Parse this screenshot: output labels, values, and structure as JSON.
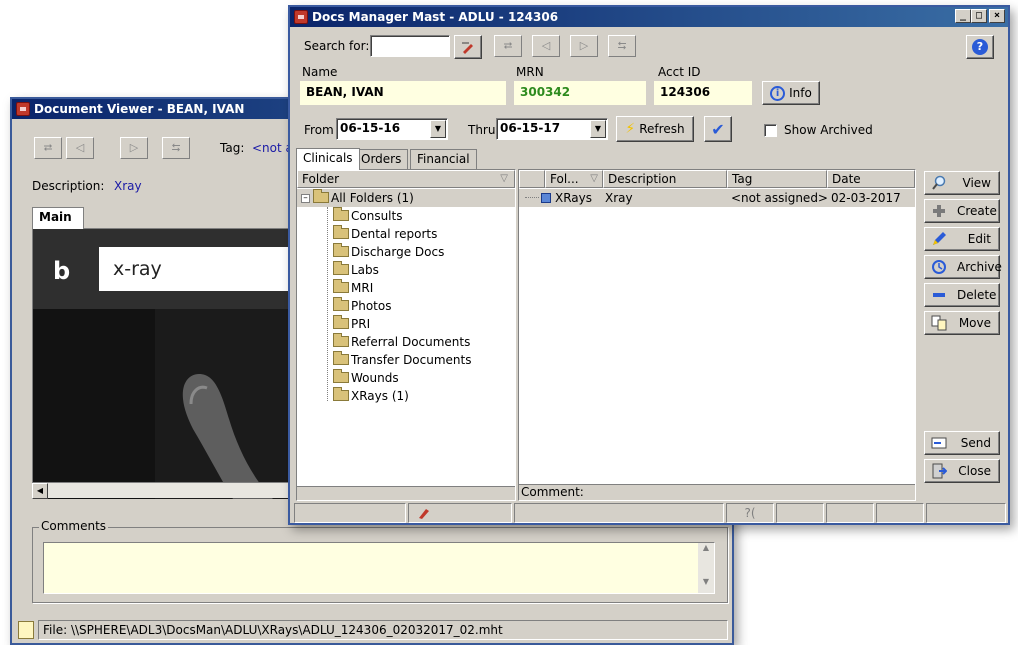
{
  "viewer": {
    "title": "Document Viewer - BEAN, IVAN",
    "tag_label": "Tag:",
    "tag_value": "<not a",
    "description_label": "Description:",
    "description_value": "Xray",
    "tab_main": "Main",
    "browser_search_text": "x-ray",
    "comments_label": "Comments",
    "file_path": "File: \\\\SPHERE\\ADL3\\DocsMan\\ADLU\\XRays\\ADLU_124306_02032017_02.mht"
  },
  "manager": {
    "title": "Docs Manager Mast - ADLU - 124306",
    "search_label": "Search for:",
    "search_value": "",
    "name_label": "Name",
    "name_value": "BEAN, IVAN",
    "mrn_label": "MRN",
    "mrn_value": "300342",
    "acct_label": "Acct ID",
    "acct_value": "124306",
    "info_label": "Info",
    "from_label": "From",
    "from_value": "06-15-16",
    "thru_label": "Thru",
    "thru_value": "06-15-17",
    "refresh_label": "Refresh",
    "show_archived_label": "Show Archived",
    "show_archived_checked": false,
    "tabs": [
      "Clinicals",
      "Orders",
      "Financial"
    ],
    "folder_header": "Folder",
    "folders": [
      {
        "label": "All Folders (1)"
      },
      {
        "label": "Consults"
      },
      {
        "label": "Dental reports"
      },
      {
        "label": "Discharge Docs"
      },
      {
        "label": "Labs"
      },
      {
        "label": "MRI"
      },
      {
        "label": "Photos"
      },
      {
        "label": "PRI"
      },
      {
        "label": "Referral Documents"
      },
      {
        "label": "Transfer Documents"
      },
      {
        "label": "Wounds"
      },
      {
        "label": "XRays (1)"
      }
    ],
    "columns": [
      "Fol...",
      "Description",
      "Tag",
      "Date"
    ],
    "rows": [
      {
        "folder": "XRays",
        "description": "Xray",
        "tag": "<not assigned>",
        "date": "02-03-2017"
      }
    ],
    "comment_label": "Comment:",
    "side_buttons": [
      "View",
      "Create",
      "Edit",
      "Archive",
      "Delete",
      "Move",
      "Send",
      "Close"
    ],
    "status_help": "?("
  },
  "colors": {
    "title_start": "#0a246a",
    "title_end": "#3a6ea5",
    "mrn_green": "#2e8b1e",
    "link_blue": "#1a1aa6",
    "yellow_bg": "#ffffe1"
  }
}
